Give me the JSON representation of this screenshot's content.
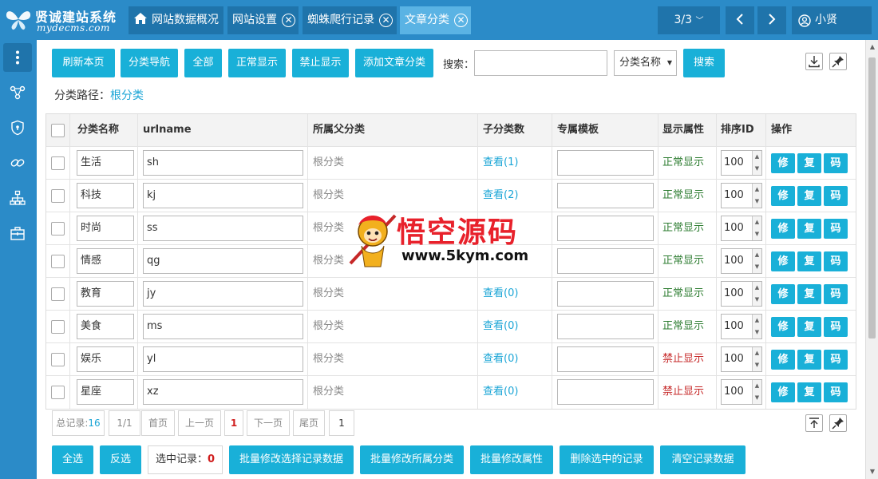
{
  "logo": {
    "title": "贤诚建站系统",
    "subtitle": "mydecms.com"
  },
  "tabs": [
    {
      "label": "网站数据概况",
      "icon": "home-icon"
    },
    {
      "label": "网站设置"
    },
    {
      "label": "蜘蛛爬行记录"
    },
    {
      "label": "文章分类"
    }
  ],
  "topbar": {
    "page_indicator": "3/3",
    "user_name": "小贤"
  },
  "toolbar": {
    "buttons": [
      "刷新本页",
      "分类导航",
      "全部",
      "正常显示",
      "禁止显示",
      "添加文章分类"
    ],
    "search_label": "搜索：",
    "search_value": "",
    "search_field": "分类名称",
    "search_button": "搜索"
  },
  "breadcrumb": {
    "label": "分类路径：",
    "root": "根分类"
  },
  "table": {
    "headers": [
      "分类名称",
      "urlname",
      "所属父分类",
      "子分类数",
      "专属模板",
      "显示属性",
      "排序ID",
      "操作"
    ],
    "rows": [
      {
        "name": "生活",
        "urlname": "sh",
        "parent": "根分类",
        "children": "查看(1)",
        "template": "",
        "status": "正常显示",
        "sort": "100"
      },
      {
        "name": "科技",
        "urlname": "kj",
        "parent": "根分类",
        "children": "查看(2)",
        "template": "",
        "status": "正常显示",
        "sort": "100"
      },
      {
        "name": "时尚",
        "urlname": "ss",
        "parent": "根分类",
        "children": "",
        "template": "",
        "status": "正常显示",
        "sort": "100"
      },
      {
        "name": "情感",
        "urlname": "qg",
        "parent": "根分类",
        "children": "",
        "template": "",
        "status": "正常显示",
        "sort": "100"
      },
      {
        "name": "教育",
        "urlname": "jy",
        "parent": "根分类",
        "children": "查看(0)",
        "template": "",
        "status": "正常显示",
        "sort": "100"
      },
      {
        "name": "美食",
        "urlname": "ms",
        "parent": "根分类",
        "children": "查看(0)",
        "template": "",
        "status": "正常显示",
        "sort": "100"
      },
      {
        "name": "娱乐",
        "urlname": "yl",
        "parent": "根分类",
        "children": "查看(0)",
        "template": "",
        "status": "禁止显示",
        "sort": "100"
      },
      {
        "name": "星座",
        "urlname": "xz",
        "parent": "根分类",
        "children": "查看(0)",
        "template": "",
        "status": "禁止显示",
        "sort": "100"
      }
    ],
    "actions": [
      "修",
      "复",
      "码"
    ]
  },
  "pager": {
    "total_label": "总记录:",
    "total_value": "16",
    "pages": "1/1",
    "first": "首页",
    "prev": "上一页",
    "current": "1",
    "next": "下一页",
    "last": "尾页",
    "jump_value": "1"
  },
  "bottom": {
    "select_all": "全选",
    "invert": "反选",
    "selected_label": "选中记录：",
    "selected_count": "0",
    "actions": [
      "批量修改选择记录数据",
      "批量修改所属分类",
      "批量修改属性",
      "删除选中的记录",
      "清空记录数据"
    ]
  },
  "watermark": {
    "title": "悟空源码",
    "url": "www.5kym.com"
  },
  "colors": {
    "primary": "#2b8bc8",
    "button": "#19b0d8",
    "link": "#1aa5d6",
    "ok": "#2e7d32",
    "forbidden": "#c62828"
  }
}
